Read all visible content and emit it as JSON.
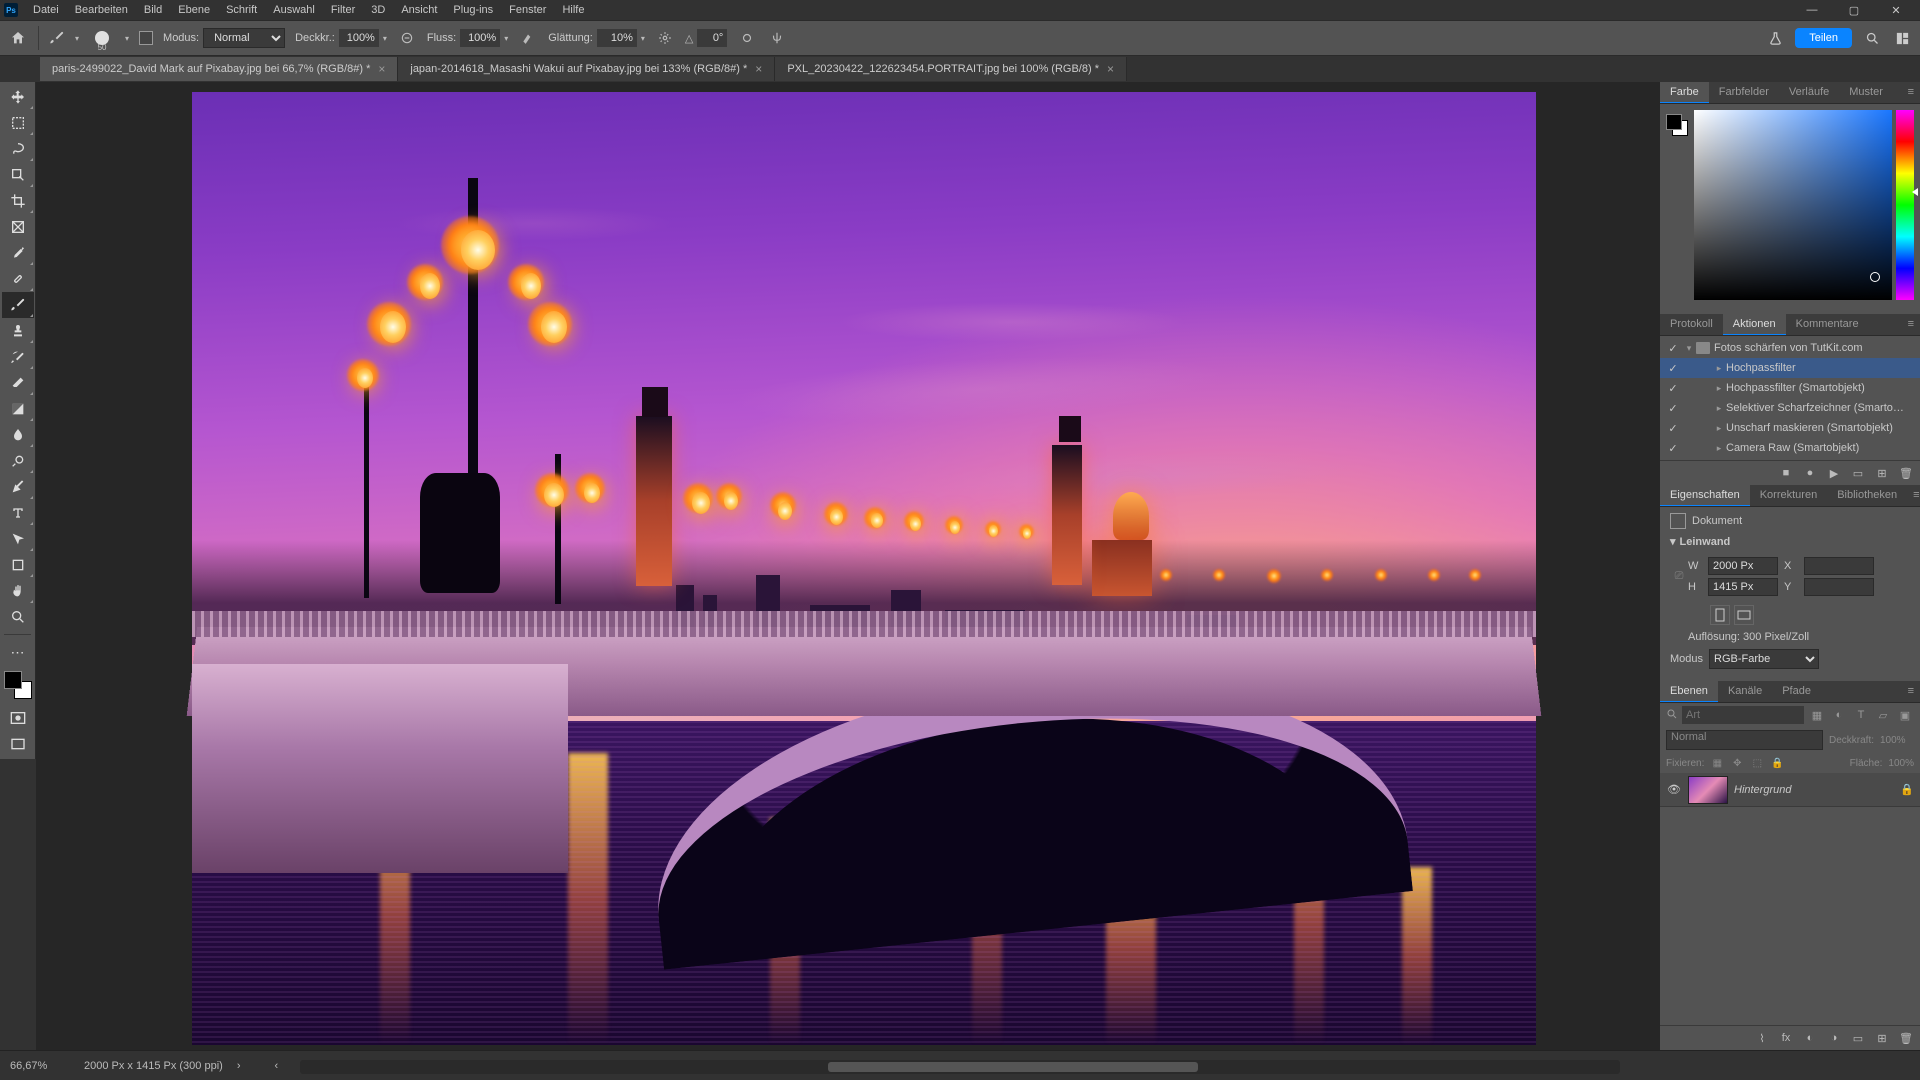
{
  "titlebar": {
    "ps": "Ps",
    "menu": [
      "Datei",
      "Bearbeiten",
      "Bild",
      "Ebene",
      "Schrift",
      "Auswahl",
      "Filter",
      "3D",
      "Ansicht",
      "Plug-ins",
      "Fenster",
      "Hilfe"
    ]
  },
  "options": {
    "brush_size": "50",
    "mode_label": "Modus:",
    "mode_value": "Normal",
    "opacity_label": "Deckkr.:",
    "opacity_value": "100%",
    "flow_label": "Fluss:",
    "flow_value": "100%",
    "smoothing_label": "Glättung:",
    "smoothing_value": "10%",
    "angle_value": "0°",
    "share": "Teilen"
  },
  "tabs": [
    {
      "label": "paris-2499022_David Mark auf Pixabay.jpg bei 66,7% (RGB/8#) *",
      "active": true
    },
    {
      "label": "japan-2014618_Masashi Wakui auf Pixabay.jpg bei 133% (RGB/8#) *",
      "active": false
    },
    {
      "label": "PXL_20230422_122623454.PORTRAIT.jpg bei 100% (RGB/8) *",
      "active": false
    }
  ],
  "color_tabs": [
    "Farbe",
    "Farbfelder",
    "Verläufe",
    "Muster"
  ],
  "actions_tabs": [
    "Protokoll",
    "Aktionen",
    "Kommentare"
  ],
  "actions_tabs_active": 1,
  "actions": {
    "set": "Fotos schärfen von TutKit.com",
    "items": [
      {
        "name": "Hochpassfilter",
        "sel": true
      },
      {
        "name": "Hochpassfilter (Smartobjekt)"
      },
      {
        "name": "Selektiver Scharfzeichner (Smarto…"
      },
      {
        "name": "Unscharf maskieren (Smartobjekt)"
      },
      {
        "name": "Camera Raw (Smartobjekt)"
      }
    ]
  },
  "props_tabs": [
    "Eigenschaften",
    "Korrekturen",
    "Bibliotheken"
  ],
  "props": {
    "doc_label": "Dokument",
    "section": "Leinwand",
    "w_label": "W",
    "w_value": "2000 Px",
    "h_label": "H",
    "h_value": "1415 Px",
    "x_label": "X",
    "y_label": "Y",
    "res_label": "Auflösung:",
    "res_value": "300 Pixel/Zoll",
    "mode_label": "Modus",
    "mode_value": "RGB-Farbe"
  },
  "layers_tabs": [
    "Ebenen",
    "Kanäle",
    "Pfade"
  ],
  "layers": {
    "search_placeholder": "Art",
    "blend": "Normal",
    "opacity_label": "Deckkraft:",
    "opacity_value": "100%",
    "lock_label": "Fixieren:",
    "fill_label": "Fläche:",
    "fill_value": "100%",
    "items": [
      {
        "name": "Hintergrund",
        "locked": true
      }
    ]
  },
  "status": {
    "zoom": "66,67%",
    "dims": "2000 Px x 1415 Px (300 ppi)"
  }
}
